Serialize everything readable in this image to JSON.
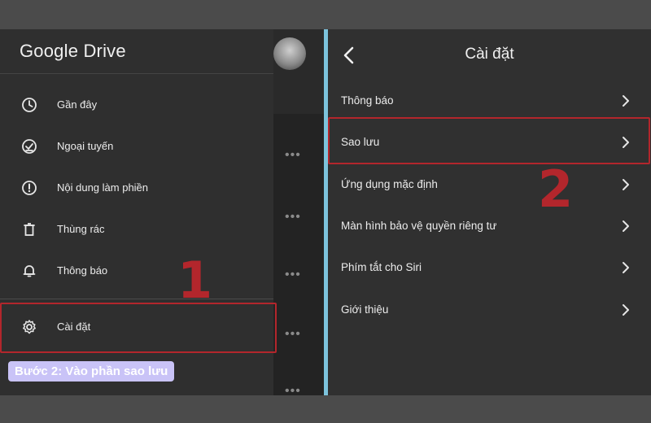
{
  "drawer": {
    "brand": "Google Drive",
    "items": [
      {
        "label": "Gần đây",
        "icon": "clock-icon"
      },
      {
        "label": "Ngoại tuyến",
        "icon": "offline-check-icon"
      },
      {
        "label": "Nội dung làm phiền",
        "icon": "alert-circle-icon"
      },
      {
        "label": "Thùng rác",
        "icon": "trash-icon"
      },
      {
        "label": "Thông báo",
        "icon": "bell-icon"
      },
      {
        "label": "Cài đặt",
        "icon": "gear-icon"
      }
    ]
  },
  "annotations": {
    "step1": "1",
    "step2": "2",
    "caption": "Bước 2: Vào phần sao lưu",
    "highlight_color": "#b3262c"
  },
  "settings": {
    "title": "Cài đặt",
    "items": [
      {
        "label": "Thông báo"
      },
      {
        "label": "Sao lưu"
      },
      {
        "label": "Ứng dụng mặc định"
      },
      {
        "label": "Màn hình bảo vệ quyền riêng tư"
      },
      {
        "label": "Phím tắt cho Siri"
      },
      {
        "label": "Giới thiệu"
      }
    ]
  }
}
